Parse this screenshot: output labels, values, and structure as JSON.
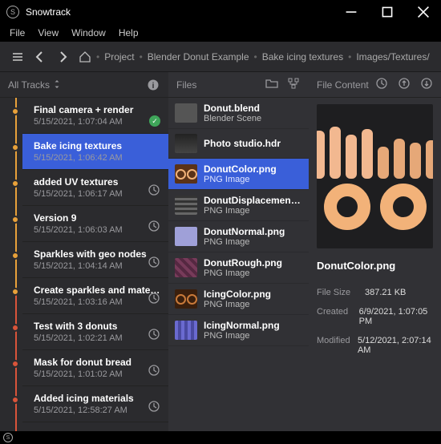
{
  "window": {
    "title": "Snowtrack"
  },
  "menu": {
    "items": [
      "File",
      "View",
      "Window",
      "Help"
    ]
  },
  "breadcrumb": {
    "items": [
      "Project",
      "Blender Donut Example",
      "Bake icing textures",
      "Images/Textures/DonutColor.pn"
    ]
  },
  "tracks": {
    "header": "All Tracks",
    "items": [
      {
        "title": "Final camera + render",
        "date": "5/15/2021, 1:07:04 AM",
        "state": "done",
        "color": "orange"
      },
      {
        "title": "Bake icing textures",
        "date": "5/15/2021, 1:06:42 AM",
        "state": "active",
        "color": "orange"
      },
      {
        "title": "added UV textures",
        "date": "5/15/2021, 1:06:17 AM",
        "state": "history",
        "color": "orange"
      },
      {
        "title": "Version 9",
        "date": "5/15/2021, 1:06:03 AM",
        "state": "history",
        "color": "orange"
      },
      {
        "title": "Sparkles with geo nodes",
        "date": "5/15/2021, 1:04:14 AM",
        "state": "history",
        "color": "orange"
      },
      {
        "title": "Create sparkles and materials",
        "date": "5/15/2021, 1:03:16 AM",
        "state": "history",
        "color": "orange"
      },
      {
        "title": "Test with 3 donuts",
        "date": "5/15/2021, 1:02:21 AM",
        "state": "history",
        "color": "red"
      },
      {
        "title": "Mask for donut bread",
        "date": "5/15/2021, 1:01:02 AM",
        "state": "history",
        "color": "red"
      },
      {
        "title": "Added icing materials",
        "date": "5/15/2021, 12:58:27 AM",
        "state": "history",
        "color": "red"
      }
    ]
  },
  "files": {
    "header": "Files",
    "items": [
      {
        "name": "Donut.blend",
        "type": "Blender Scene",
        "thumb": "blend"
      },
      {
        "name": "Photo studio.hdr",
        "type": "",
        "thumb": "hdr"
      },
      {
        "name": "DonutColor.png",
        "type": "PNG Image",
        "thumb": "color",
        "selected": true
      },
      {
        "name": "DonutDisplacement.png",
        "type": "PNG Image",
        "thumb": "disp"
      },
      {
        "name": "DonutNormal.png",
        "type": "PNG Image",
        "thumb": "norm"
      },
      {
        "name": "DonutRough.png",
        "type": "PNG Image",
        "thumb": "rough"
      },
      {
        "name": "IcingColor.png",
        "type": "PNG Image",
        "thumb": "icing"
      },
      {
        "name": "IcingNormal.png",
        "type": "PNG Image",
        "thumb": "icnorm"
      }
    ]
  },
  "details": {
    "header": "File Content",
    "name": "DonutColor.png",
    "meta": {
      "size_label": "File Size",
      "size": "387.21 KB",
      "created_label": "Created",
      "created": "6/9/2021, 1:07:05 PM",
      "modified_label": "Modified",
      "modified": "5/12/2021, 2:07:14 AM"
    }
  }
}
